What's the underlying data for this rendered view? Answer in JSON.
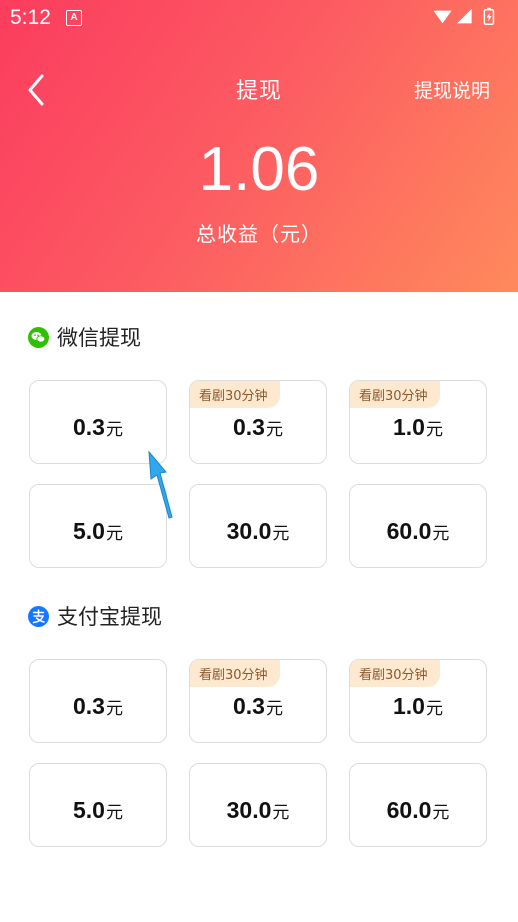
{
  "status_bar": {
    "time": "5:12",
    "app_badge": "A"
  },
  "nav": {
    "title": "提现",
    "help": "提现说明"
  },
  "summary": {
    "amount": "1.06",
    "label": "总收益（元）"
  },
  "unit": "元",
  "sections": [
    {
      "title": "微信提现",
      "icon": "wechat-icon",
      "options": [
        {
          "value": "0.3",
          "tag": ""
        },
        {
          "value": "0.3",
          "tag": "看剧30分钟"
        },
        {
          "value": "1.0",
          "tag": "看剧30分钟"
        },
        {
          "value": "5.0",
          "tag": ""
        },
        {
          "value": "30.0",
          "tag": ""
        },
        {
          "value": "60.0",
          "tag": ""
        }
      ]
    },
    {
      "title": "支付宝提现",
      "icon": "alipay-icon",
      "options": [
        {
          "value": "0.3",
          "tag": ""
        },
        {
          "value": "0.3",
          "tag": "看剧30分钟"
        },
        {
          "value": "1.0",
          "tag": "看剧30分钟"
        },
        {
          "value": "5.0",
          "tag": ""
        },
        {
          "value": "30.0",
          "tag": ""
        },
        {
          "value": "60.0",
          "tag": ""
        }
      ]
    }
  ],
  "colors": {
    "gradient_start": "#fb3c5e",
    "gradient_end": "#ff8a5c",
    "tag_bg": "#fde9cf",
    "tag_text": "#8a5a2e",
    "wechat_green": "#2dc100",
    "alipay_blue": "#1677ff",
    "pointer_blue": "#2fa8f0"
  }
}
